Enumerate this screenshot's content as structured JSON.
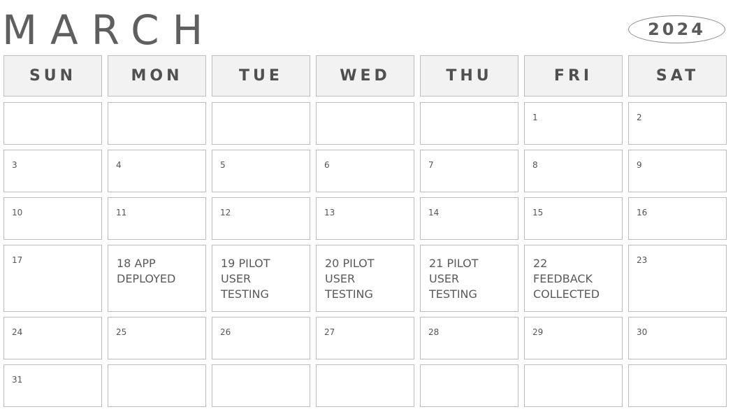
{
  "title": {
    "month": "MARCH",
    "year": "2024"
  },
  "weekdays": [
    "SUN",
    "MON",
    "TUE",
    "WED",
    "THU",
    "FRI",
    "SAT"
  ],
  "weeks": [
    [
      {
        "day": ""
      },
      {
        "day": ""
      },
      {
        "day": ""
      },
      {
        "day": ""
      },
      {
        "day": ""
      },
      {
        "day": "1"
      },
      {
        "day": "2"
      }
    ],
    [
      {
        "day": "3"
      },
      {
        "day": "4"
      },
      {
        "day": "5"
      },
      {
        "day": "6"
      },
      {
        "day": "7"
      },
      {
        "day": "8"
      },
      {
        "day": "9"
      }
    ],
    [
      {
        "day": "10"
      },
      {
        "day": "11"
      },
      {
        "day": "12"
      },
      {
        "day": "13"
      },
      {
        "day": "14"
      },
      {
        "day": "15"
      },
      {
        "day": "16"
      }
    ],
    [
      {
        "day": "17"
      },
      {
        "event": "18 APP\nDEPLOYED"
      },
      {
        "event": "19  PILOT\nUSER\nTESTING"
      },
      {
        "event": "20 PILOT\nUSER\nTESTING"
      },
      {
        "event": "21 PILOT\nUSER\nTESTING"
      },
      {
        "event": "22\nFEEDBACK\nCOLLECTED"
      },
      {
        "day": "23"
      }
    ],
    [
      {
        "day": "24"
      },
      {
        "day": "25"
      },
      {
        "day": "26"
      },
      {
        "day": "27"
      },
      {
        "day": "28"
      },
      {
        "day": "29"
      },
      {
        "day": "30"
      }
    ],
    [
      {
        "day": "31"
      },
      {
        "day": ""
      },
      {
        "day": ""
      },
      {
        "day": ""
      },
      {
        "day": ""
      },
      {
        "day": ""
      },
      {
        "day": ""
      }
    ]
  ]
}
